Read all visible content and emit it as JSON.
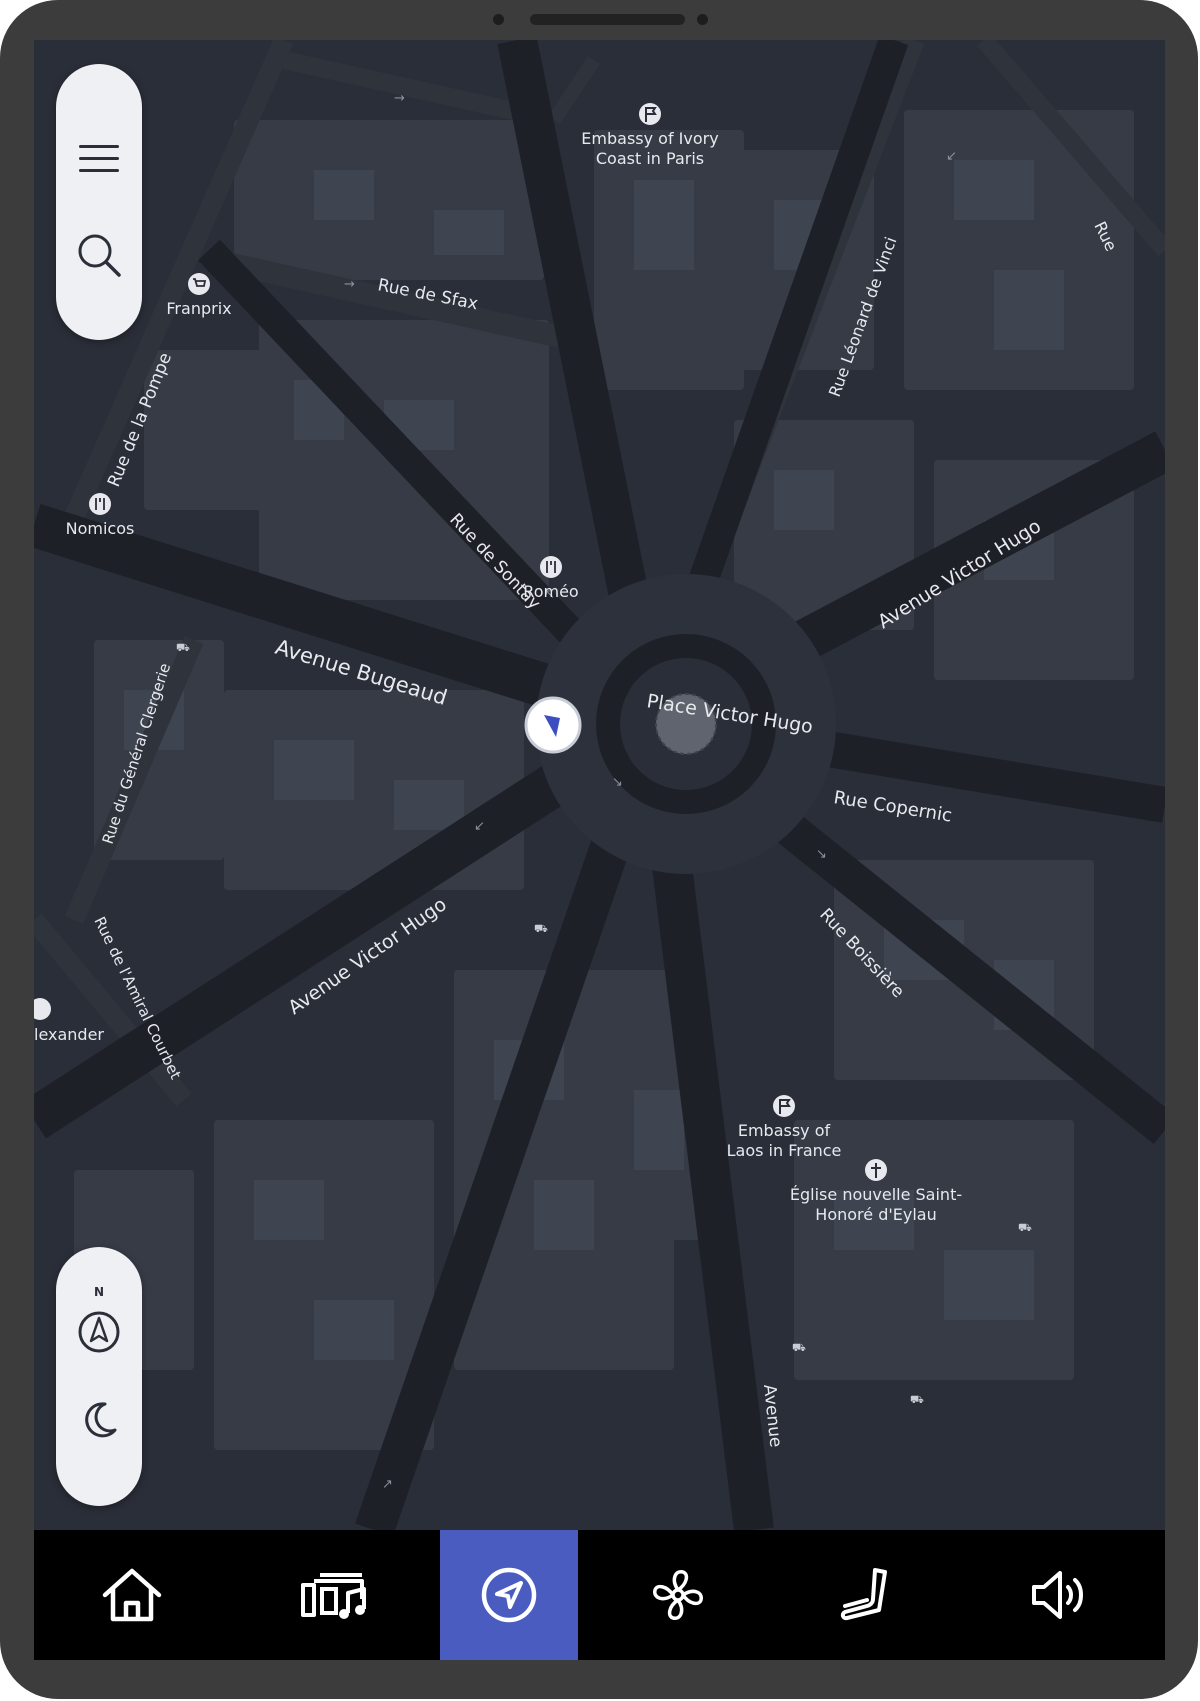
{
  "map": {
    "streets": [
      {
        "id": "rue-de-sfax",
        "name": "Rue de Sfax"
      },
      {
        "id": "rue-de-la-pompe",
        "name": "Rue de la Pompe"
      },
      {
        "id": "rue-de-sontay",
        "name": "Rue de Sontay"
      },
      {
        "id": "avenue-bugeaud",
        "name": "Avenue Bugeaud"
      },
      {
        "id": "rue-du-general-clergerie",
        "name": "Rue du Général Clergerie"
      },
      {
        "id": "rue-leonard-de-vinci",
        "name": "Rue Léonard de Vinci"
      },
      {
        "id": "avenue-victor-hugo-ne",
        "name": "Avenue Victor Hugo"
      },
      {
        "id": "place-victor-hugo",
        "name": "Place Victor Hugo"
      },
      {
        "id": "rue-copernic",
        "name": "Rue Copernic"
      },
      {
        "id": "rue-boissiere",
        "name": "Rue Boissière"
      },
      {
        "id": "avenue-victor-hugo-sw",
        "name": "Avenue Victor Hugo"
      },
      {
        "id": "rue-de-l-amiral-courbet",
        "name": "Rue de l'Amiral Courbet"
      },
      {
        "id": "avenue-partial",
        "name": "Avenue"
      },
      {
        "id": "rue-partial",
        "name": "Rue"
      }
    ],
    "pois": [
      {
        "id": "embassy-ivory-coast",
        "icon": "flag-icon",
        "lines": [
          "Embassy of Ivory",
          "Coast in Paris"
        ]
      },
      {
        "id": "franprix",
        "icon": "shopping-cart-icon",
        "lines": [
          "Franprix"
        ]
      },
      {
        "id": "nomicos",
        "icon": "restaurant-icon",
        "lines": [
          "Nomicos"
        ]
      },
      {
        "id": "romeo",
        "icon": "restaurant-icon",
        "lines": [
          "Roméo"
        ]
      },
      {
        "id": "alexander",
        "icon": "cinema-icon",
        "lines": [
          "lexander"
        ]
      },
      {
        "id": "embassy-laos",
        "icon": "flag-icon",
        "lines": [
          "Embassy of",
          "Laos in France"
        ]
      },
      {
        "id": "eglise-saint-honore",
        "icon": "church-icon",
        "lines": [
          "Église nouvelle Saint-",
          "Honoré d'Eylau"
        ]
      }
    ],
    "compass_north_label": "N",
    "position_marker": "navigation-arrow-icon"
  },
  "controls": {
    "menu": "menu-icon",
    "search": "search-icon",
    "compass": "compass-icon",
    "night_mode": "moon-icon"
  },
  "nav": {
    "items": [
      {
        "id": "home",
        "icon": "home-icon",
        "active": false
      },
      {
        "id": "media",
        "icon": "media-icon",
        "active": false
      },
      {
        "id": "navigation",
        "icon": "navigation-icon",
        "active": true
      },
      {
        "id": "climate",
        "icon": "fan-icon",
        "active": false
      },
      {
        "id": "seat",
        "icon": "seat-icon",
        "active": false
      },
      {
        "id": "volume",
        "icon": "volume-icon",
        "active": false
      }
    ],
    "active_color": "#4a5cc0"
  },
  "colors": {
    "map_background": "#2a2e38",
    "block": "#373c47",
    "road": "#1d2027",
    "label": "#e7e9ee",
    "frame": "#3c3c3c"
  }
}
